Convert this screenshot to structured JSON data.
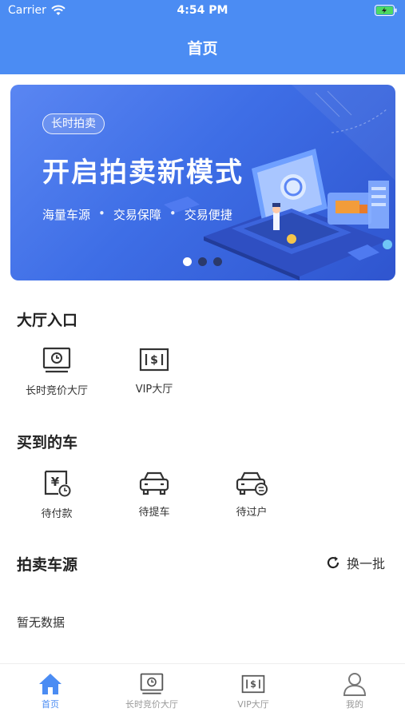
{
  "status_bar": {
    "carrier": "Carrier",
    "time": "4:54 PM"
  },
  "header": {
    "title": "首页"
  },
  "banner": {
    "tag": "长时拍卖",
    "headline": "开启拍卖新模式",
    "features": [
      "海量车源",
      "交易保障",
      "交易便捷"
    ],
    "page_count": 3,
    "active_page": 1
  },
  "hall": {
    "title": "大厅入口",
    "items": [
      {
        "label": "长时竞价大厅",
        "icon": "monitor-clock-icon"
      },
      {
        "label": "VIP大厅",
        "icon": "cash-icon"
      }
    ]
  },
  "purchased": {
    "title": "买到的车",
    "items": [
      {
        "label": "待付款",
        "icon": "yuan-clock-icon"
      },
      {
        "label": "待提车",
        "icon": "car-icon"
      },
      {
        "label": "待过户",
        "icon": "car-transfer-icon"
      }
    ]
  },
  "auction": {
    "title": "拍卖车源",
    "refresh_label": "换一批",
    "empty_text": "暂无数据"
  },
  "tabbar": {
    "items": [
      {
        "label": "首页",
        "icon": "home-icon",
        "active": true
      },
      {
        "label": "长时竞价大厅",
        "icon": "monitor-clock-icon",
        "active": false
      },
      {
        "label": "VIP大厅",
        "icon": "cash-icon",
        "active": false
      },
      {
        "label": "我的",
        "icon": "user-icon",
        "active": false
      }
    ]
  },
  "colors": {
    "primary": "#4b8cf3",
    "inactive": "#999999"
  }
}
